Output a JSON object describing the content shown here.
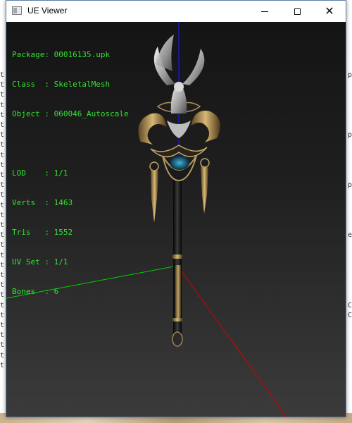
{
  "window": {
    "title": "UE Viewer",
    "minimize_glyph": "minimize-icon",
    "maximize_glyph": "maximize-icon",
    "close_glyph": "✕"
  },
  "info": {
    "package": "Package: 00016135.upk",
    "class": "Class  : SkeletalMesh",
    "object": "Object : 060046_Autoscale",
    "lod": "LOD    : 1/1",
    "verts": "Verts  : 1463",
    "tris": "Tris   : 1552",
    "uvset": "UV Set : 1/1",
    "bones": "Bones  : 6"
  },
  "colors": {
    "text": "#34e034",
    "axis_x": "#c00000",
    "axis_y": "#00d000",
    "axis_z": "#1010e0"
  },
  "background": {
    "left_chars": [
      "t",
      "t",
      "t",
      "t",
      "t",
      "t",
      "t",
      "t",
      "t",
      "t",
      "t",
      "t",
      "t",
      "t",
      "t",
      "t",
      "t",
      "t",
      "t",
      "t",
      "t",
      "t",
      "t",
      "t",
      "t",
      "t",
      "t",
      "t",
      "t",
      "t"
    ],
    "right_chars": [
      "p",
      "",
      "",
      "",
      "",
      "",
      "p",
      "",
      "",
      "",
      "",
      "p",
      "",
      "",
      "",
      "",
      "e",
      "",
      "",
      "",
      "",
      "",
      "",
      "C",
      "C",
      "",
      "",
      "",
      "",
      ""
    ]
  }
}
